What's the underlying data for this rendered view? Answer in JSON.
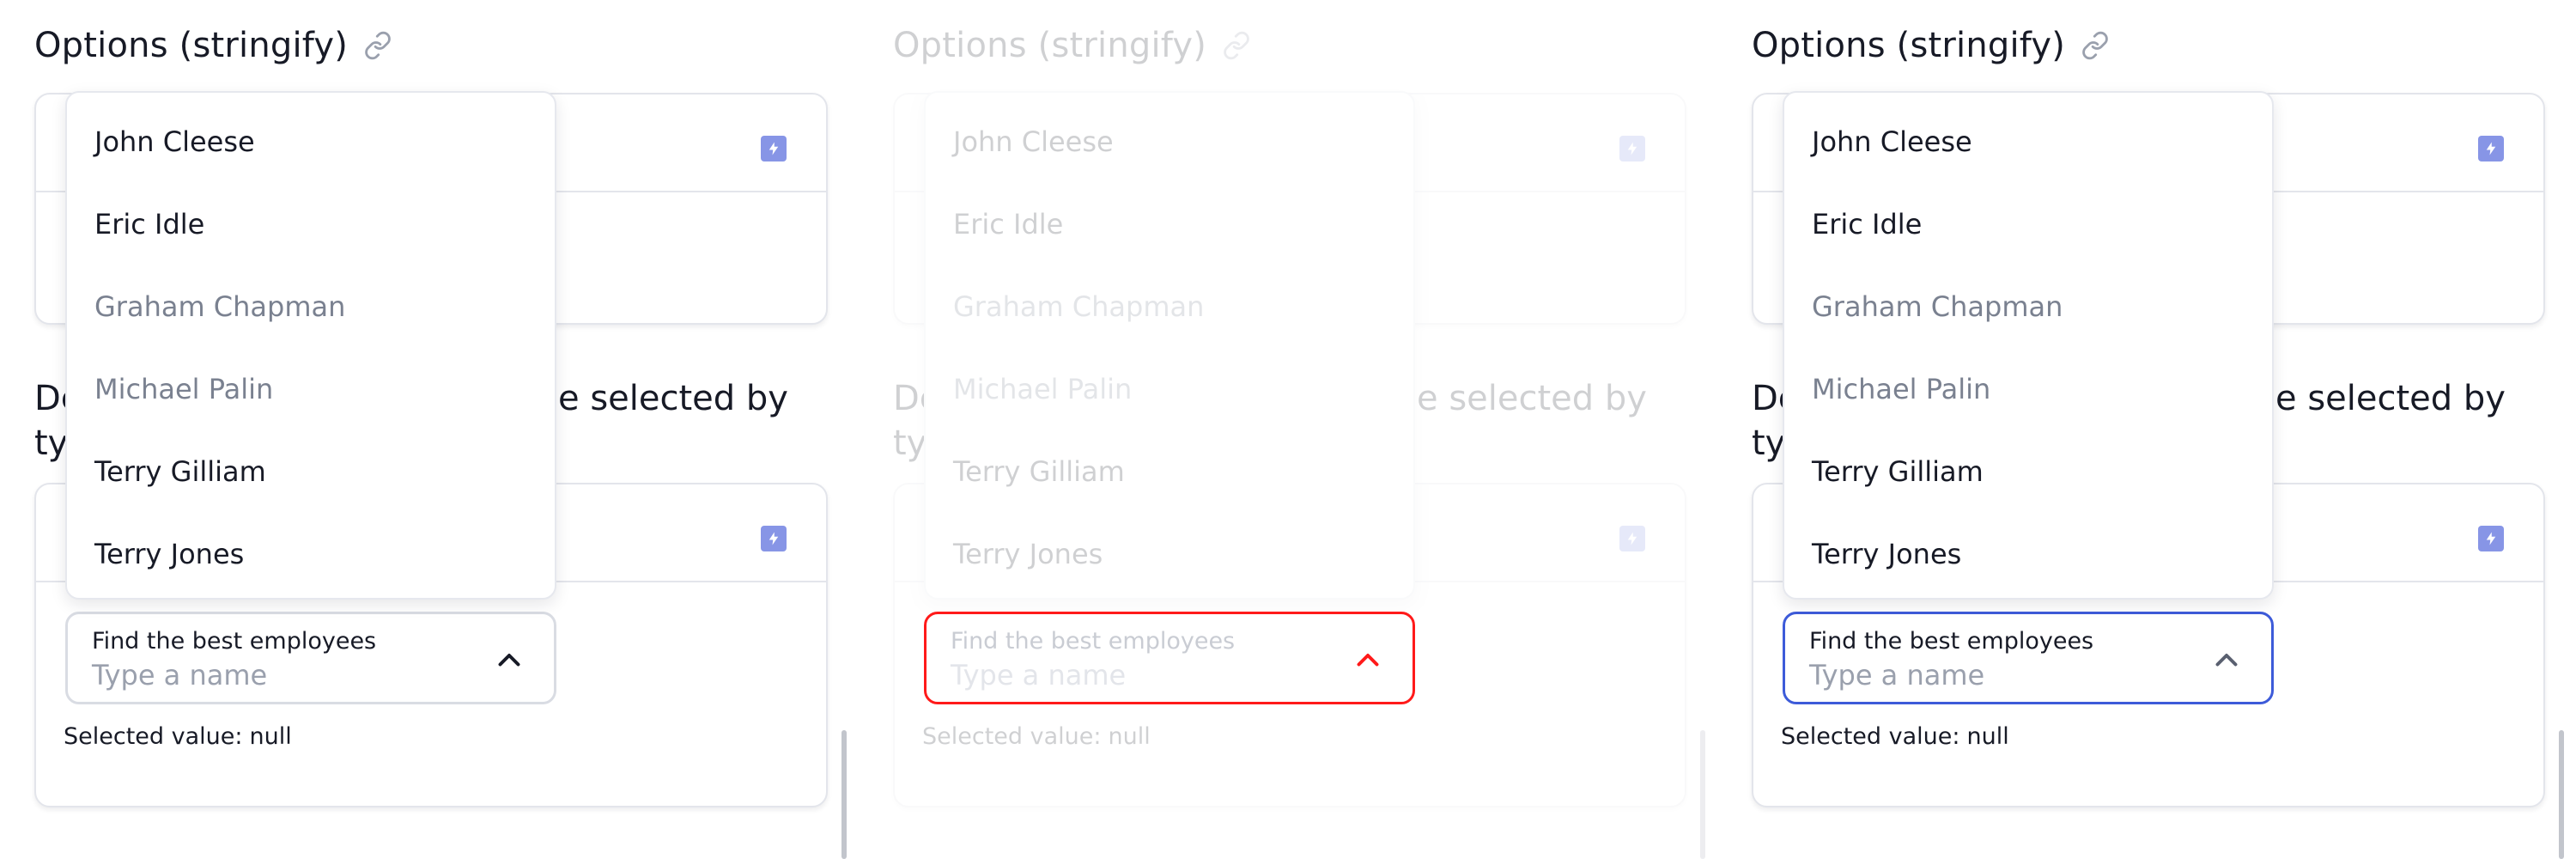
{
  "panels": [
    {
      "heading": "Options (stringify)",
      "link_icon": "link-icon",
      "section_line1a": "De",
      "section_line1b": "e selected by",
      "section_line2": "ty",
      "combo": {
        "label": "Find the best employees",
        "placeholder": "Type a name",
        "state": "neutral",
        "border_color": "#d9dce3"
      },
      "selected_value": {
        "label": "Selected value:",
        "value": "null"
      },
      "options": [
        "John Cleese",
        "Eric Idle",
        "Graham Chapman",
        "Michael Palin",
        "Terry Gilliam",
        "Terry Jones"
      ]
    },
    {
      "heading": "Options (stringify)",
      "link_icon": "link-icon",
      "section_line1a": "De",
      "section_line1b": "e selected by",
      "section_line2": "ty",
      "combo": {
        "label": "Find the best employees",
        "placeholder": "Type a name",
        "state": "error",
        "border_color": "#ff1a1a"
      },
      "selected_value": {
        "label": "Selected value:",
        "value": "null"
      },
      "options": [
        "John Cleese",
        "Eric Idle",
        "Graham Chapman",
        "Michael Palin",
        "Terry Gilliam",
        "Terry Jones"
      ]
    },
    {
      "heading": "Options (stringify)",
      "link_icon": "link-icon",
      "section_line1a": "De",
      "section_line1b": "e selected by",
      "section_line2": "ty",
      "combo": {
        "label": "Find the best employees",
        "placeholder": "Type a name",
        "state": "focused",
        "border_color": "#3d5bd9"
      },
      "selected_value": {
        "label": "Selected value:",
        "value": "null"
      },
      "options": [
        "John Cleese",
        "Eric Idle",
        "Graham Chapman",
        "Michael Palin",
        "Terry Gilliam",
        "Terry Jones"
      ]
    }
  ],
  "colors": {
    "text": "#171a26",
    "muted_option": "#7a8190",
    "placeholder": "#9aa0ad",
    "accent_bolt": "#8795e6",
    "error": "#ff1a1a",
    "focus": "#3d5bd9"
  },
  "icons": {
    "bolt": "lightning-bolt-icon",
    "chevron": "chevron-up-icon"
  }
}
